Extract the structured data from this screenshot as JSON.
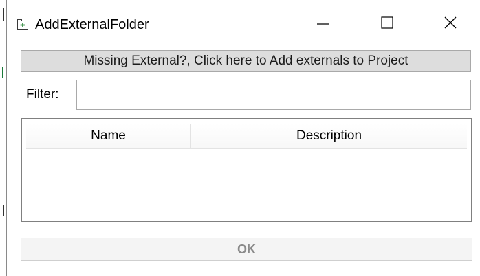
{
  "window": {
    "title": "AddExternalFolder",
    "title_icon": "folder-plus-icon",
    "icon_color": "#2e8b3e"
  },
  "titlebar_buttons": {
    "minimize": "minimize-icon",
    "maximize": "maximize-icon",
    "close": "close-icon"
  },
  "add_externals_button": {
    "label": "Missing External?, Click here to Add externals to Project"
  },
  "filter": {
    "label": "Filter:",
    "value": "",
    "placeholder": ""
  },
  "list": {
    "columns": [
      "Name",
      "Description"
    ],
    "rows": []
  },
  "ok_button": {
    "label": "OK",
    "enabled": false
  }
}
